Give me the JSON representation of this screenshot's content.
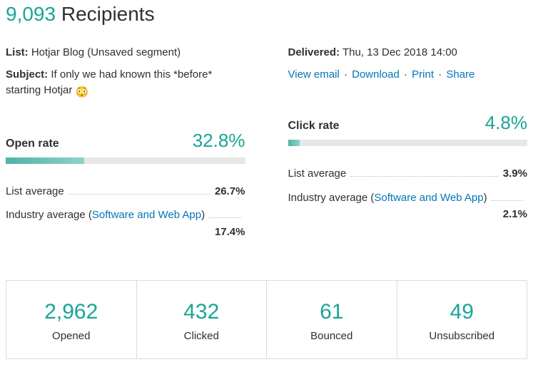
{
  "header": {
    "count": "9,093",
    "label": "Recipients"
  },
  "left_meta": {
    "list_label": "List:",
    "list_value": "Hotjar Blog (Unsaved segment)",
    "subject_label": "Subject:",
    "subject_value": "If only we had known this *before* starting Hotjar",
    "subject_emoji": "😳"
  },
  "right_meta": {
    "delivered_label": "Delivered:",
    "delivered_value": "Thu, 13 Dec 2018 14:00",
    "actions": {
      "view": "View email",
      "download": "Download",
      "print": "Print",
      "share": "Share"
    }
  },
  "open_rate": {
    "title": "Open rate",
    "value": "32.8%",
    "bar_pct": 32.8,
    "list_avg_label": "List average",
    "list_avg_value": "26.7%",
    "industry_label_prefix": "Industry average (",
    "industry_link": "Software and Web App",
    "industry_label_suffix": ")",
    "industry_value": "17.4%"
  },
  "click_rate": {
    "title": "Click rate",
    "value": "4.8%",
    "bar_pct": 4.8,
    "list_avg_label": "List average",
    "list_avg_value": "3.9%",
    "industry_label_prefix": "Industry average (",
    "industry_link": "Software and Web App",
    "industry_label_suffix": ")",
    "industry_value": "2.1%"
  },
  "stats": {
    "opened": {
      "num": "2,962",
      "label": "Opened"
    },
    "clicked": {
      "num": "432",
      "label": "Clicked"
    },
    "bounced": {
      "num": "61",
      "label": "Bounced"
    },
    "unsubscribed": {
      "num": "49",
      "label": "Unsubscribed"
    }
  }
}
